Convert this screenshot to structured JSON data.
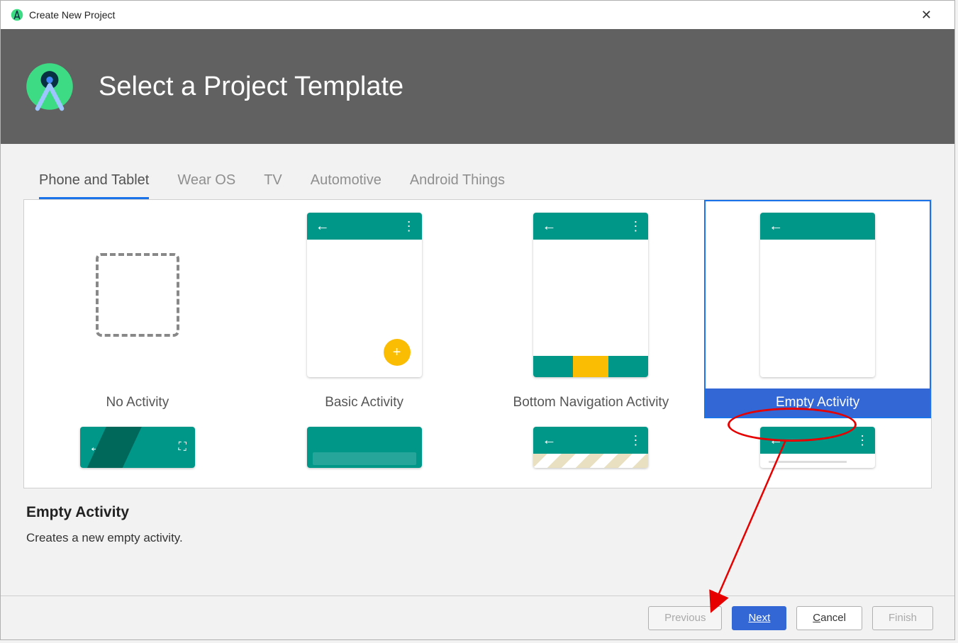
{
  "window": {
    "title": "Create New Project"
  },
  "header": {
    "title": "Select a Project Template"
  },
  "tabs": [
    {
      "label": "Phone and Tablet",
      "active": true
    },
    {
      "label": "Wear OS",
      "active": false
    },
    {
      "label": "TV",
      "active": false
    },
    {
      "label": "Automotive",
      "active": false
    },
    {
      "label": "Android Things",
      "active": false
    }
  ],
  "templates_row1": [
    {
      "label": "No Activity"
    },
    {
      "label": "Basic Activity"
    },
    {
      "label": "Bottom Navigation Activity"
    },
    {
      "label": "Empty Activity",
      "selected": true
    }
  ],
  "description": {
    "title": "Empty Activity",
    "text": "Creates a new empty activity."
  },
  "buttons": {
    "previous": "Previous",
    "next": "Next",
    "cancel": "Cancel",
    "finish": "Finish"
  },
  "icons": {
    "back": "←",
    "dots": "⋮",
    "plus": "+",
    "close": "✕",
    "expand": "⛶"
  }
}
